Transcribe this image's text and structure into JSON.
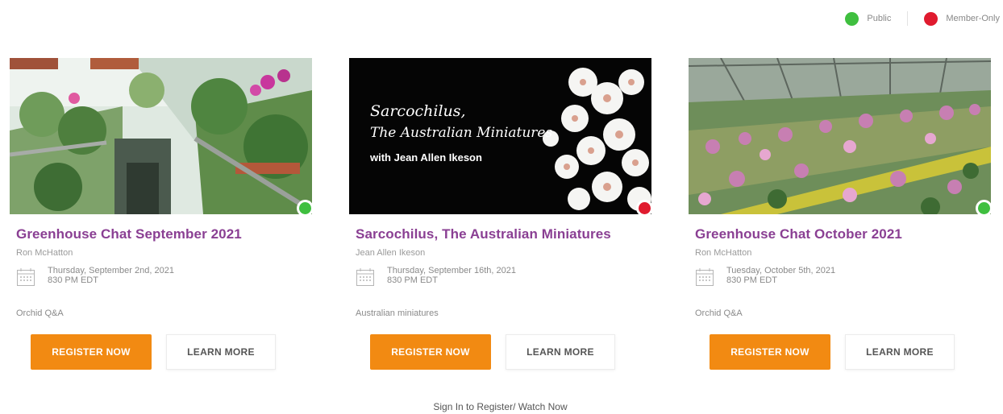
{
  "legend": {
    "public_label": "Public",
    "public_color": "#3fbf3f",
    "member_label": "Member-Only",
    "member_color": "#e01b2f"
  },
  "events": [
    {
      "title": "Greenhouse Chat September 2021",
      "speaker": "Ron McHatton",
      "date": "Thursday, September 2nd, 2021",
      "time": "830 PM EDT",
      "tag": "Orchid Q&A",
      "access": "public",
      "status_color": "#3fbf3f",
      "register_label": "REGISTER NOW",
      "learn_label": "LEARN MORE"
    },
    {
      "title": "Sarcochilus, The Australian Miniatures",
      "speaker": "Jean Allen Ikeson",
      "date": "Thursday, September 16th, 2021",
      "time": "830 PM EDT",
      "tag": "Australian miniatures",
      "access": "member-only",
      "status_color": "#e01b2f",
      "register_label": "REGISTER NOW",
      "learn_label": "LEARN MORE",
      "image_text": {
        "line1": "Sarcochilus,",
        "line2": "The Australian Miniatures",
        "line3": "with Jean Allen Ikeson"
      }
    },
    {
      "title": "Greenhouse Chat October 2021",
      "speaker": "Ron McHatton",
      "date": "Tuesday, October 5th, 2021",
      "time": "830 PM EDT",
      "tag": "Orchid Q&A",
      "access": "public",
      "status_color": "#3fbf3f",
      "register_label": "REGISTER NOW",
      "learn_label": "LEARN MORE"
    }
  ],
  "signin_text": "Sign In to Register/ Watch Now",
  "colors": {
    "title": "#8a3f93",
    "register_button": "#f28a12"
  }
}
